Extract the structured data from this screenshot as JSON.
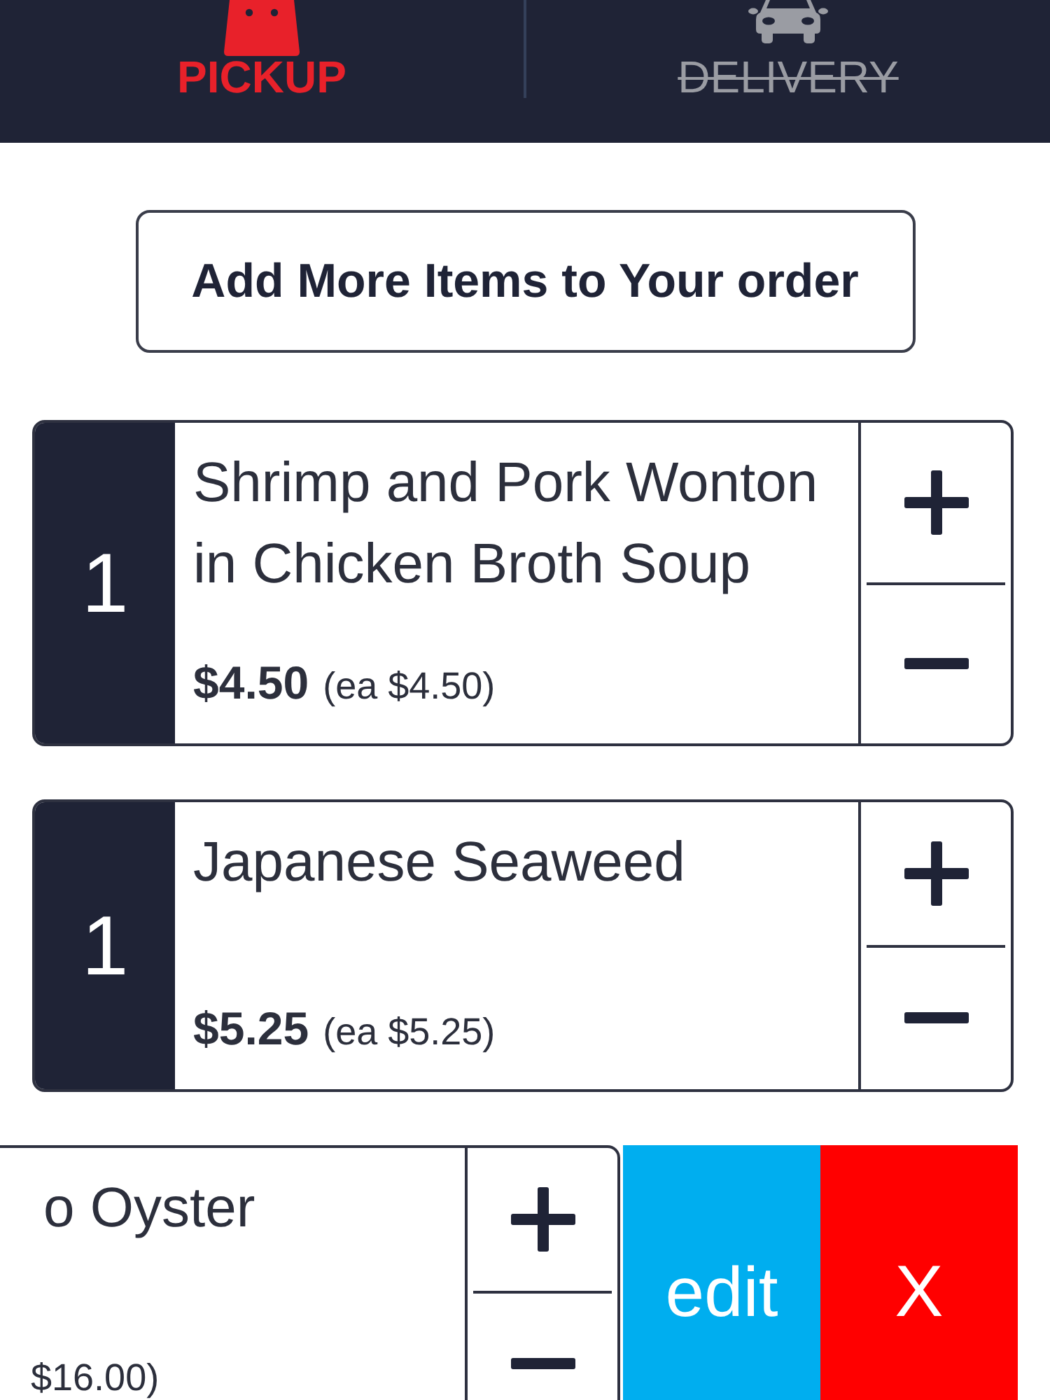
{
  "tabs": [
    {
      "kind": "pickup",
      "label": "PICKUP",
      "selected": true,
      "disabled": false
    },
    {
      "kind": "delivery",
      "label": "DELIVERY",
      "selected": false,
      "disabled": true
    }
  ],
  "add_items_button": "Add More Items to Your order",
  "cart_items": [
    {
      "swiped": false,
      "quantity": "1",
      "name": "Shrimp and Pork Wonton in Chicken Broth Soup",
      "price": "$4.50",
      "each_price": "(ea $4.50)"
    },
    {
      "swiped": false,
      "quantity": "1",
      "name": "Japanese Seaweed",
      "price": "$5.25",
      "each_price": "(ea $5.25)"
    },
    {
      "swiped": true,
      "name": "o Oyster",
      "each_price": "$16.00)",
      "actions": [
        {
          "kind": "edit",
          "label": "edit"
        },
        {
          "kind": "delete",
          "label": "X"
        }
      ]
    }
  ]
}
